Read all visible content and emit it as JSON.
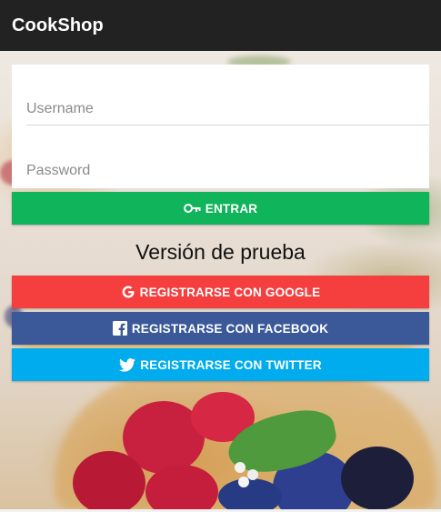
{
  "app": {
    "title": "CookShop"
  },
  "login": {
    "username_placeholder": "Username",
    "password_placeholder": "Password",
    "enter_label": "ENTRAR",
    "enter_icon": "key-icon",
    "enter_color": "#10b45a"
  },
  "trial": {
    "label": "Versión de prueba"
  },
  "social": {
    "google": {
      "label": "REGISTRARSE CON GOOGLE",
      "icon": "google-icon",
      "color": "#f53f3f"
    },
    "facebook": {
      "label": "REGISTRARSE CON FACEBOOK",
      "icon": "facebook-icon",
      "color": "#3b5998"
    },
    "twitter": {
      "label": "REGISTRARSE CON TWITTER",
      "icon": "twitter-icon",
      "color": "#00acee"
    }
  }
}
